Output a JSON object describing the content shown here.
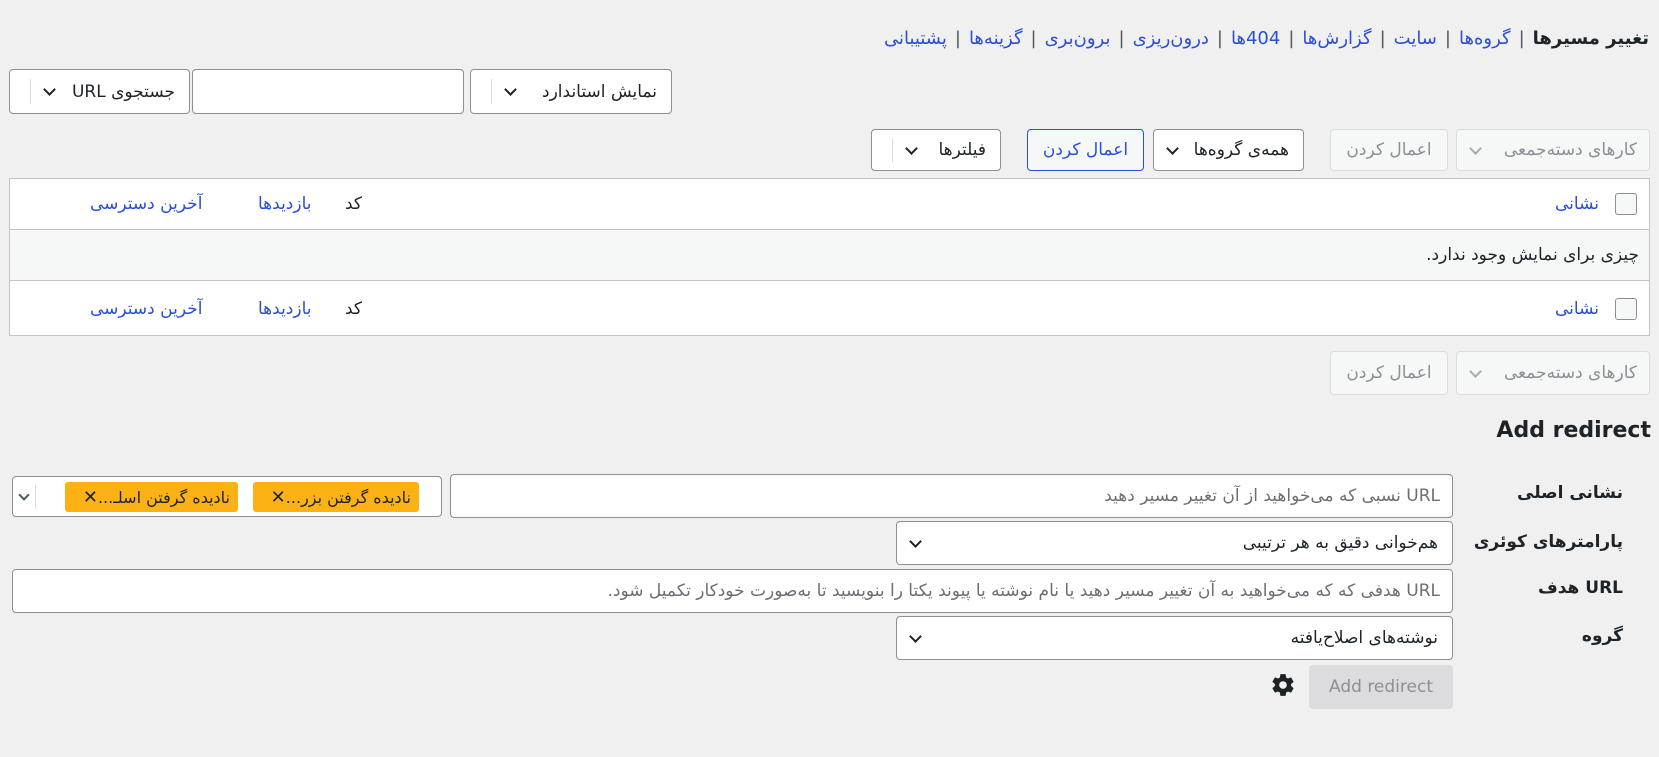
{
  "nav": {
    "current": "تغییر مسیرها",
    "items": [
      "گروه‌ها",
      "سایت",
      "گزارش‌ها",
      "404ها",
      "درون‌ریزی",
      "برون‌بری",
      "گزینه‌ها",
      "پشتیبانی"
    ],
    "separator": "|"
  },
  "toolbar_top": {
    "display_mode": "نمایش استاندارد",
    "search_value": "",
    "search_type": "جستجوی URL"
  },
  "toolbar": {
    "bulk_actions": "کارهای دسته‌جمعی",
    "apply": "اعمال کردن",
    "groups_filter": "همه‌ی گروه‌ها",
    "apply_filter": "اعمال کردن",
    "filters": "فیلترها"
  },
  "table": {
    "columns": {
      "url": "نشانی",
      "code": "کد",
      "hits": "بازدیدها",
      "last_access": "آخرین دسترسی"
    },
    "empty_message": "چیزی برای نمایش وجود ندارد."
  },
  "bottom_toolbar": {
    "bulk_actions": "کارهای دسته‌جمعی",
    "apply": "اعمال کردن"
  },
  "add_redirect": {
    "heading": "Add redirect",
    "source_label": "نشانی اصلی",
    "source_placeholder": "URL نسبی که می‌خواهید از آن تغییر مسیر دهید",
    "tags": [
      "نادیده گرفتن بزر...",
      "نادیده گرفتن اسلـ..."
    ],
    "tag_remove": "✕",
    "query_label": "پارامترهای کوئری",
    "query_value": "هم‌خوانی دقیق به هر ترتیبی",
    "target_label": "URL هدف",
    "target_placeholder": "URL هدفی که که می‌خواهید به آن تغییر مسیر دهید یا نام نوشته یا پیوند یکتا را بنویسید تا به‌صورت خودکار تکمیل شود.",
    "group_label": "گروه",
    "group_value": "نوشته‌های اصلاح‌یافته",
    "submit": "Add redirect",
    "settings_icon": "gear-icon"
  }
}
